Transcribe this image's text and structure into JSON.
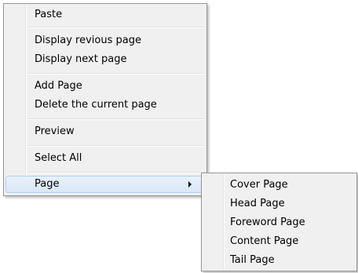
{
  "context_menu": {
    "items": [
      {
        "label": "Paste"
      },
      {
        "label": "Display revious page"
      },
      {
        "label": "Display next page"
      },
      {
        "label": "Add Page"
      },
      {
        "label": "Delete the current page"
      },
      {
        "label": "Preview"
      },
      {
        "label": "Select All"
      },
      {
        "label": "Page",
        "has_submenu": true,
        "highlighted": true
      }
    ]
  },
  "submenu": {
    "items": [
      {
        "label": "Cover Page"
      },
      {
        "label": "Head Page"
      },
      {
        "label": "Foreword Page"
      },
      {
        "label": "Content Page"
      },
      {
        "label": "Tail Page"
      }
    ]
  },
  "icons": {
    "submenu_arrow": "chevron-right-icon"
  },
  "colors": {
    "menu_background": "#f0f0f0",
    "menu_border": "#979797",
    "highlight_border": "#aecff7",
    "highlight_fill": "#d9e7f7"
  }
}
